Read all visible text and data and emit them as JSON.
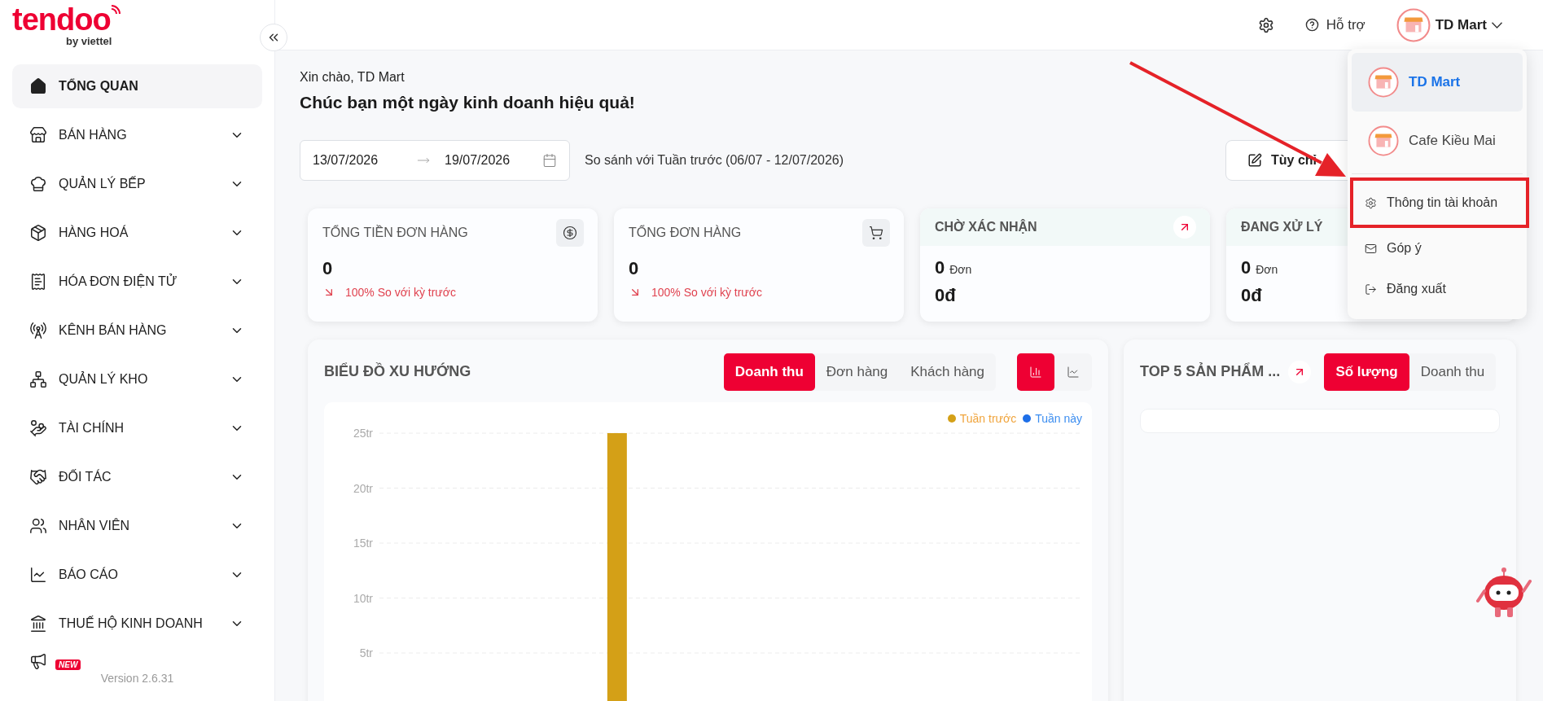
{
  "sidebar": {
    "logo": {
      "brand": "tendoo",
      "tagline": "by viettel"
    },
    "items": [
      {
        "label": "TỔNG QUAN",
        "selected": true,
        "expandable": false
      },
      {
        "label": "BÁN HÀNG",
        "selected": false,
        "expandable": true
      },
      {
        "label": "QUẢN LÝ BẾP",
        "selected": false,
        "expandable": true
      },
      {
        "label": "HÀNG HOÁ",
        "selected": false,
        "expandable": true
      },
      {
        "label": "HÓA ĐƠN ĐIỆN TỬ",
        "selected": false,
        "expandable": true
      },
      {
        "label": "KÊNH BÁN HÀNG",
        "selected": false,
        "expandable": true
      },
      {
        "label": "QUẢN LÝ KHO",
        "selected": false,
        "expandable": true
      },
      {
        "label": "TÀI CHÍNH",
        "selected": false,
        "expandable": true
      },
      {
        "label": "ĐỐI TÁC",
        "selected": false,
        "expandable": true
      },
      {
        "label": "NHÂN VIÊN",
        "selected": false,
        "expandable": true
      },
      {
        "label": "BÁO CÁO",
        "selected": false,
        "expandable": true
      },
      {
        "label": "THUẾ HỘ KINH DOANH",
        "selected": false,
        "expandable": true
      }
    ],
    "marketing_badge": "NEW",
    "version": "Version 2.6.31"
  },
  "header": {
    "support": "Hỗ trợ",
    "account": "TD Mart"
  },
  "account_menu": {
    "stores": [
      {
        "name": "TD Mart",
        "selected": true
      },
      {
        "name": "Cafe Kiều Mai",
        "selected": false
      }
    ],
    "items": [
      {
        "label": "Thông tin tài khoản",
        "highlighted": true
      },
      {
        "label": "Góp ý",
        "highlighted": false
      },
      {
        "label": "Đăng xuất",
        "highlighted": false
      }
    ]
  },
  "greeting": {
    "hello": "Xin chào, TD Mart",
    "wish": "Chúc bạn một ngày kinh doanh hiệu quả!"
  },
  "date_range": {
    "start": "13/07/2026",
    "end": "19/07/2026"
  },
  "compare_text": "So sánh với Tuần trước (06/07 - 12/07/2026)",
  "customize_button": "Tùy chỉ",
  "stat_cards": [
    {
      "kind": "total",
      "title": "TỔNG TIỀN ĐƠN HÀNG",
      "value": "0",
      "change": "100% So với kỳ trước"
    },
    {
      "kind": "total",
      "title": "TỔNG ĐƠN HÀNG",
      "value": "0",
      "change": "100% So với kỳ trước"
    },
    {
      "kind": "status",
      "title": "CHỜ XÁC NHẬN",
      "count": "0",
      "unit": "Đơn",
      "amount": "0đ"
    },
    {
      "kind": "status",
      "title": "ĐANG XỬ LÝ",
      "count": "0",
      "unit": "Đơn",
      "amount": "0đ"
    }
  ],
  "trend_chart": {
    "title": "BIỂU ĐỒ XU HƯỚNG",
    "tabs": [
      {
        "label": "Doanh thu",
        "selected": true
      },
      {
        "label": "Đơn hàng",
        "selected": false
      },
      {
        "label": "Khách hàng",
        "selected": false
      }
    ],
    "views": [
      {
        "kind": "bar",
        "selected": true
      },
      {
        "kind": "line",
        "selected": false
      }
    ],
    "chart_data": {
      "type": "bar",
      "ylim": [
        0,
        25
      ],
      "grid": true,
      "series": [
        {
          "name": "Tuần trước",
          "color": "#d4a017",
          "values": [
            0,
            0,
            25,
            0,
            0,
            0,
            0
          ]
        },
        {
          "name": "Tuần này",
          "color": "#1e6fe8",
          "values": [
            0,
            0,
            0,
            0,
            0,
            0,
            0
          ]
        }
      ],
      "yticks": [
        {
          "value": 5,
          "label": "5tr"
        },
        {
          "value": 10,
          "label": "10tr"
        },
        {
          "value": 15,
          "label": "15tr"
        },
        {
          "value": 20,
          "label": "20tr"
        },
        {
          "value": 25,
          "label": "25tr"
        }
      ]
    }
  },
  "top_products": {
    "title": "TOP 5 SẢN PHẨM ...",
    "tabs": [
      {
        "label": "Số lượng",
        "selected": true
      },
      {
        "label": "Doanh thu",
        "selected": false
      }
    ]
  }
}
